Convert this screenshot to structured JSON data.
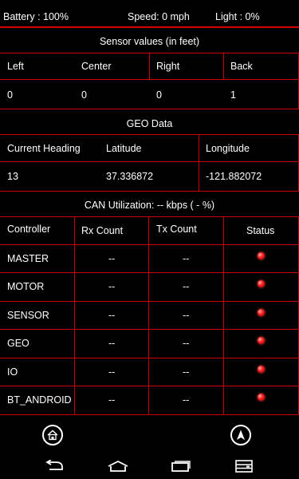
{
  "status": {
    "battery": "Battery : 100%",
    "speed": "Speed: 0 mph",
    "light": "Light : 0%"
  },
  "sensor": {
    "title": "Sensor values (in feet)",
    "headers": [
      "Left",
      "Center",
      "Right",
      "Back"
    ],
    "values": [
      "0",
      "0",
      "0",
      "1"
    ]
  },
  "geo": {
    "title": "GEO Data",
    "headers": [
      "Current Heading",
      "Latitude",
      "Longitude"
    ],
    "values": [
      "13",
      "37.336872",
      "-121.882072"
    ]
  },
  "can": {
    "title": "CAN Utilization: -- kbps ( - %)",
    "headers": [
      "Controller",
      "Rx Count",
      "Tx Count",
      "Status"
    ],
    "rows": [
      {
        "controller": "MASTER",
        "rx": "--",
        "tx": "--"
      },
      {
        "controller": "MOTOR",
        "rx": "--",
        "tx": "--"
      },
      {
        "controller": "SENSOR",
        "rx": "--",
        "tx": "--"
      },
      {
        "controller": "GEO",
        "rx": "--",
        "tx": "--"
      },
      {
        "controller": "IO",
        "rx": "--",
        "tx": "--"
      },
      {
        "controller": "BT_ANDROID",
        "rx": "--",
        "tx": "--"
      }
    ],
    "status_color": "#ff2020"
  },
  "icons": {
    "home": "home-icon",
    "navigate": "navigation-arrow-icon",
    "back": "back-icon",
    "nav_home": "nav-home-icon",
    "recents": "recents-icon",
    "menu": "menu-icon"
  },
  "colors": {
    "accent": "#d00000",
    "background": "#000000"
  }
}
